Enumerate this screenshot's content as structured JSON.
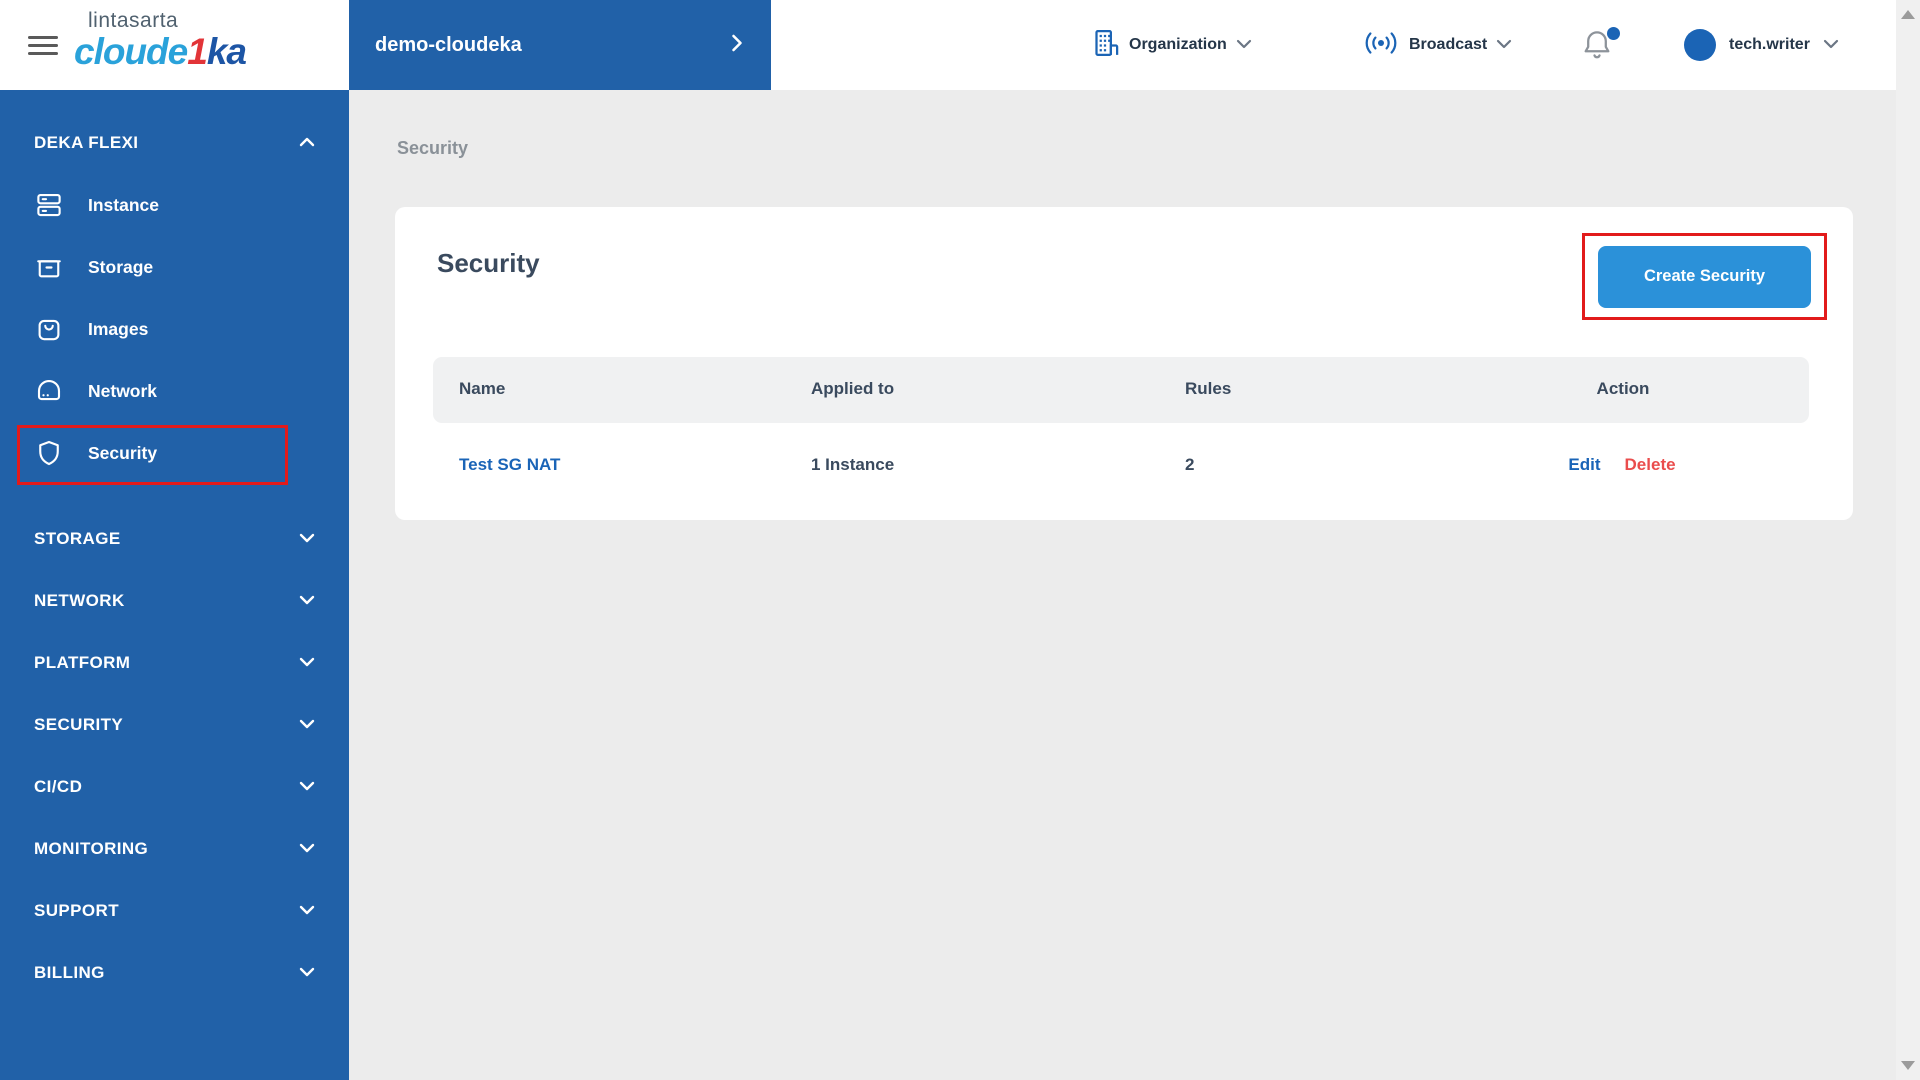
{
  "brand": {
    "company": "lintasarta",
    "product_blue": "cloude",
    "product_red": "1",
    "product_navy": "ka"
  },
  "header": {
    "project_name": "demo-cloudeka",
    "organization_label": "Organization",
    "broadcast_label": "Broadcast",
    "user_name": "tech.writer"
  },
  "sidebar": {
    "deka_flexi": {
      "label": "DEKA FLEXI",
      "items": [
        {
          "label": "Instance",
          "icon": "server-icon"
        },
        {
          "label": "Storage",
          "icon": "storage-box-icon"
        },
        {
          "label": "Images",
          "icon": "images-bag-icon"
        },
        {
          "label": "Network",
          "icon": "network-drive-icon"
        },
        {
          "label": "Security",
          "icon": "shield-icon",
          "annotated": true
        }
      ]
    },
    "sections": [
      {
        "label": "STORAGE"
      },
      {
        "label": "NETWORK"
      },
      {
        "label": "PLATFORM"
      },
      {
        "label": "SECURITY"
      },
      {
        "label": "CI/CD"
      },
      {
        "label": "MONITORING"
      },
      {
        "label": "SUPPORT"
      },
      {
        "label": "BILLING"
      }
    ]
  },
  "breadcrumb": {
    "current": "Security"
  },
  "main": {
    "card_title": "Security",
    "create_button_label": "Create Security",
    "table": {
      "columns": [
        "Name",
        "Applied to",
        "Rules",
        "Action"
      ],
      "rows": [
        {
          "name": "Test SG NAT",
          "applied_to": "1 Instance",
          "rules": "2",
          "edit_label": "Edit",
          "delete_label": "Delete"
        }
      ]
    }
  },
  "colors": {
    "primary_blue": "#2161a8",
    "button_blue": "#2b91d9",
    "link_blue": "#1a64b7",
    "delete_red": "#ea4d4d",
    "annotation_red": "#e21b1b",
    "logo_light_blue": "#2aa2da",
    "logo_red": "#e23438",
    "logo_navy": "#1d55a5"
  }
}
